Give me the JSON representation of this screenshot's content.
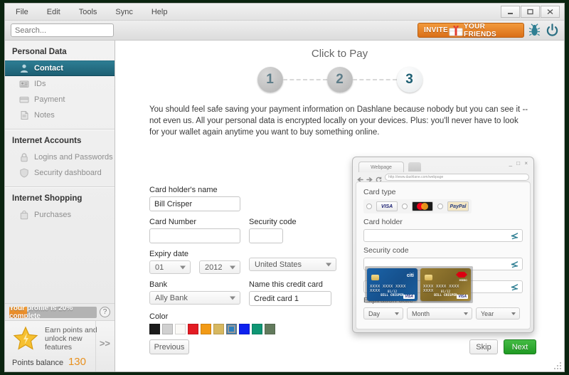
{
  "window": {
    "menu": [
      "File",
      "Edit",
      "Tools",
      "Sync",
      "Help"
    ],
    "controls": {
      "minimize": "minimize-icon",
      "maximize": "maximize-icon",
      "close": "close-icon"
    }
  },
  "search": {
    "placeholder": "Search...",
    "value": ""
  },
  "invite": {
    "left_label": "INVITE",
    "right_label": "YOUR FRIENDS",
    "icon": "gift-icon"
  },
  "toolbar_icons": {
    "bug": "bug-icon",
    "power": "power-icon"
  },
  "sidebar": {
    "sections": [
      {
        "title": "Personal Data",
        "items": [
          {
            "label": "Contact",
            "icon": "person-icon",
            "active": true
          },
          {
            "label": "IDs",
            "icon": "id-card-icon",
            "active": false
          },
          {
            "label": "Payment",
            "icon": "credit-card-icon",
            "active": false
          },
          {
            "label": "Notes",
            "icon": "note-icon",
            "active": false
          }
        ]
      },
      {
        "title": "Internet Accounts",
        "items": [
          {
            "label": "Logins and Passwords",
            "icon": "lock-icon",
            "active": false
          },
          {
            "label": "Security dashboard",
            "icon": "shield-icon",
            "active": false
          }
        ]
      },
      {
        "title": "Internet Shopping",
        "items": [
          {
            "label": "Purchases",
            "icon": "shopping-bag-icon",
            "active": false
          }
        ]
      }
    ],
    "profile": {
      "progress_text": "Your profile is 20% complete",
      "progress_percent": 20,
      "help_glyph": "?"
    },
    "points": {
      "promo_text": "Earn points and unlock new features",
      "balance_label": "Points balance",
      "balance_value": "130",
      "expand_glyph": ">>",
      "star_icon": "star-icon"
    }
  },
  "main": {
    "title": "Click to Pay",
    "steps": [
      {
        "number": "1",
        "current": false
      },
      {
        "number": "2",
        "current": false
      },
      {
        "number": "3",
        "current": true
      }
    ],
    "intro": "You should feel safe saving your payment information on Dashlane because nobody but you can see it -- not even us. All your personal data is encrypted locally on your devices. Plus: you'll never have to look for your wallet again anytime you want to buy something online.",
    "form": {
      "country": {
        "value": "United States"
      },
      "card_holder": {
        "label": "Card holder's name",
        "value": "Bill Crisper"
      },
      "card_number": {
        "label": "Card Number",
        "value": ""
      },
      "security_code": {
        "label": "Security code",
        "value": ""
      },
      "expiry": {
        "label": "Expiry date",
        "month": "01",
        "year": "2012"
      },
      "bank": {
        "label": "Bank",
        "value": "Ally Bank"
      },
      "card_name": {
        "label": "Name this credit card",
        "value": "Credit card 1"
      },
      "color": {
        "label": "Color",
        "swatches": [
          {
            "hex": "#1c1c1c",
            "selected": false
          },
          {
            "hex": "#d0d0d0",
            "selected": false
          },
          {
            "hex": "#fbfaf7",
            "selected": false
          },
          {
            "hex": "#e31b23",
            "selected": false
          },
          {
            "hex": "#f29a16",
            "selected": false
          },
          {
            "hex": "#d7b860",
            "selected": false
          },
          {
            "hex": "#2c7fbd",
            "selected": true
          },
          {
            "hex": "#0d21ef",
            "selected": false
          },
          {
            "hex": "#0f9674",
            "selected": false
          },
          {
            "hex": "#627a5c",
            "selected": false
          }
        ]
      }
    },
    "buttons": {
      "previous": "Previous",
      "skip": "Skip",
      "next": "Next"
    }
  },
  "popup": {
    "tab_label": "Webpage",
    "new_tab_icon": "new-tab-icon",
    "window_controls": "_ □ ×",
    "nav": {
      "back_icon": "back-arrow-icon",
      "forward_icon": "forward-arrow-icon",
      "reload_icon": "reload-icon",
      "url": "http://www.dashlane.com/webpage"
    },
    "card_type": {
      "label": "Card type",
      "options": [
        {
          "name": "VISA",
          "selected": false
        },
        {
          "name": "MasterCard",
          "selected": false
        },
        {
          "name": "PayPal",
          "selected": false
        }
      ]
    },
    "card_holder": {
      "label": "Card holder",
      "value": ""
    },
    "security_code": {
      "label": "Security code",
      "value": ""
    },
    "expiration": {
      "label": "Expiration date",
      "day": "Day",
      "month": "Month",
      "year": "Year"
    },
    "autofill_icon": "dashlane-autofill-icon",
    "card_picker": {
      "cards": [
        {
          "brand": "citi",
          "number": "XXXX XXXX XXXX XXXX",
          "expiry": "01/12",
          "holder": "BILL CRISPER",
          "network": "VISA",
          "theme": "blue"
        },
        {
          "brand": "HSBC",
          "number": "XXXX XXXX XXXX XXXX",
          "expiry": "01/12",
          "holder": "BILL CRISPER",
          "network": "VISA",
          "theme": "gold"
        }
      ]
    }
  }
}
